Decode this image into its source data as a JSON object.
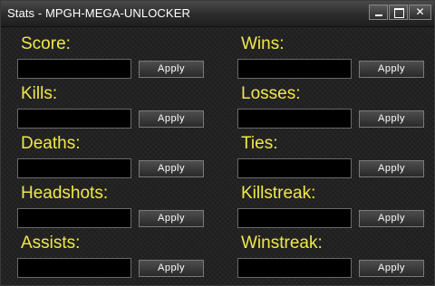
{
  "window": {
    "title": "Stats - MPGH-MEGA-UNLOCKER",
    "minimize_label": "",
    "maximize_label": "",
    "close_label": "✕"
  },
  "stats": [
    {
      "label": "Score:",
      "value": "",
      "apply_label": "Apply"
    },
    {
      "label": "Wins:",
      "value": "",
      "apply_label": "Apply"
    },
    {
      "label": "Kills:",
      "value": "",
      "apply_label": "Apply"
    },
    {
      "label": "Losses:",
      "value": "",
      "apply_label": "Apply"
    },
    {
      "label": "Deaths:",
      "value": "",
      "apply_label": "Apply"
    },
    {
      "label": "Ties:",
      "value": "",
      "apply_label": "Apply"
    },
    {
      "label": "Headshots:",
      "value": "",
      "apply_label": "Apply"
    },
    {
      "label": "Killstreak:",
      "value": "",
      "apply_label": "Apply"
    },
    {
      "label": "Assists:",
      "value": "",
      "apply_label": "Apply"
    },
    {
      "label": "Winstreak:",
      "value": "",
      "apply_label": "Apply"
    }
  ],
  "colors": {
    "label_text": "#f0e84a",
    "background": "#1e1e1e",
    "input_background": "#000000"
  }
}
